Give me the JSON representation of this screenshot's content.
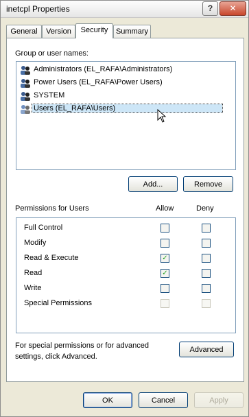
{
  "window": {
    "title": "inetcpl Properties",
    "help_button": "?",
    "close_button": "✕"
  },
  "tabs": [
    {
      "label": "General",
      "active": false
    },
    {
      "label": "Version",
      "active": false
    },
    {
      "label": "Security",
      "active": true
    },
    {
      "label": "Summary",
      "active": false
    }
  ],
  "security": {
    "group_label": "Group or user names:",
    "users": [
      {
        "name": "Administrators (EL_RAFA\\Administrators)",
        "icon": "group-icon",
        "selected": false
      },
      {
        "name": "Power Users (EL_RAFA\\Power Users)",
        "icon": "group-icon",
        "selected": false
      },
      {
        "name": "SYSTEM",
        "icon": "group-icon",
        "selected": false
      },
      {
        "name": "Users (EL_RAFA\\Users)",
        "icon": "group-icon",
        "selected": true
      }
    ],
    "add_button": "Add...",
    "remove_button": "Remove",
    "permissions_label": "Permissions for Users",
    "allow_header": "Allow",
    "deny_header": "Deny",
    "permissions": [
      {
        "name": "Full Control",
        "allow": false,
        "deny": false,
        "enabled": true
      },
      {
        "name": "Modify",
        "allow": false,
        "deny": false,
        "enabled": true
      },
      {
        "name": "Read & Execute",
        "allow": true,
        "deny": false,
        "enabled": true
      },
      {
        "name": "Read",
        "allow": true,
        "deny": false,
        "enabled": true
      },
      {
        "name": "Write",
        "allow": false,
        "deny": false,
        "enabled": true
      },
      {
        "name": "Special Permissions",
        "allow": false,
        "deny": false,
        "enabled": false
      }
    ],
    "advanced_text_line1": "For special permissions or for advanced",
    "advanced_text_line2": "settings, click Advanced.",
    "advanced_button": "Advanced"
  },
  "footer": {
    "ok_button": "OK",
    "cancel_button": "Cancel",
    "apply_button": "Apply"
  }
}
